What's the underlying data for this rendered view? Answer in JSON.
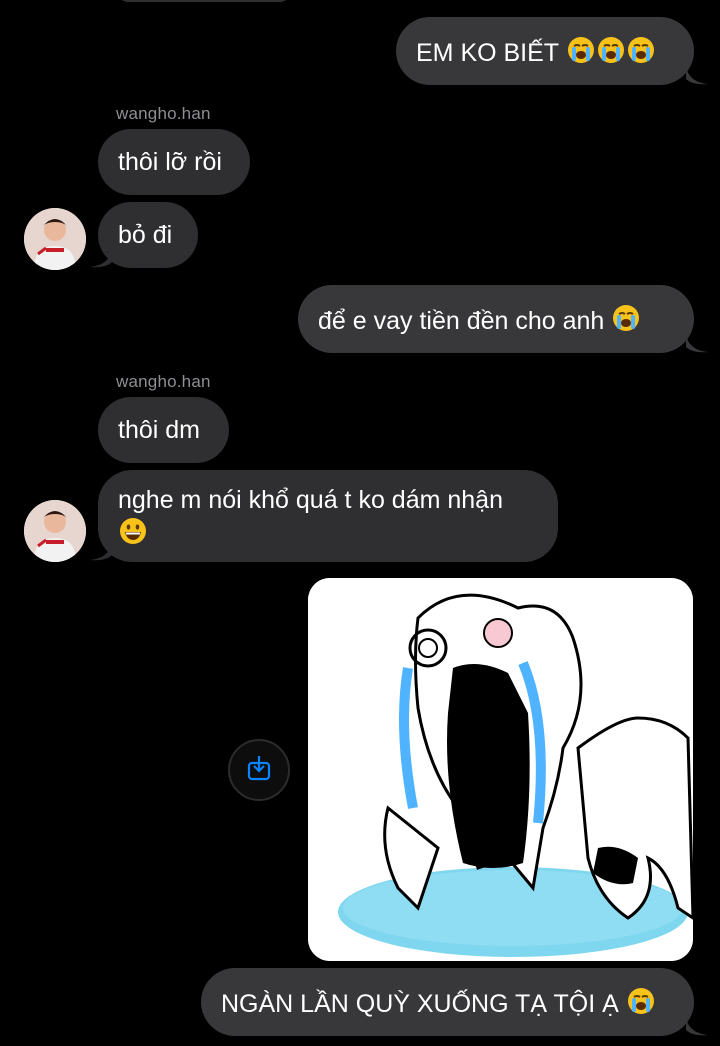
{
  "messages": [
    {
      "id": "m1",
      "side": "out",
      "text": "EM KO BIẾT",
      "emoji": [
        "crying-face",
        "crying-face",
        "crying-face"
      ]
    },
    {
      "id": "m2",
      "side": "in",
      "sender": "wangho.han",
      "text": "thôi lỡ rồi"
    },
    {
      "id": "m3",
      "side": "in",
      "text": "bỏ đi"
    },
    {
      "id": "m4",
      "side": "out",
      "text": "để e vay tiền đền cho anh",
      "emoji": [
        "crying-face"
      ]
    },
    {
      "id": "m5",
      "side": "in",
      "sender": "wangho.han",
      "text": "thôi dm"
    },
    {
      "id": "m6",
      "side": "in",
      "text_line1": "nghe m nói khổ quá t ko dám nhận",
      "emoji": [
        "grinning-face"
      ]
    },
    {
      "id": "m7",
      "side": "out",
      "type": "image",
      "image_subject": "crying rage-face meme"
    },
    {
      "id": "m8",
      "side": "out",
      "text": "NGÀN LẦN QUỲ XUỐNG TẠ TỘI Ạ",
      "emoji": [
        "crying-face"
      ]
    }
  ],
  "senders": {
    "a": "wangho.han",
    "b": "wangho.han"
  },
  "colors": {
    "background": "#000000",
    "bubble_out": "#38383a",
    "bubble_in": "#2f2f31",
    "sender_text": "#8e8e93",
    "share_icon": "#0a84ff"
  }
}
